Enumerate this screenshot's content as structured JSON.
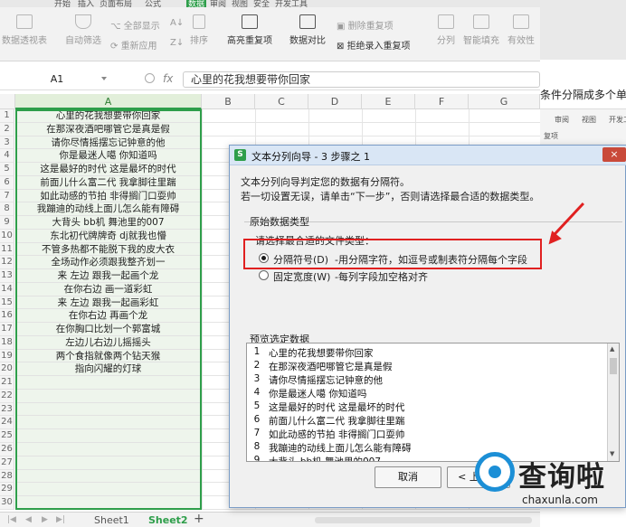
{
  "ribbon": {
    "tabs": [
      "开始",
      "插入",
      "页面布局",
      "公式",
      "数据",
      "审阅",
      "视图",
      "安全",
      "开发工具"
    ],
    "buttons": {
      "pivot": "数据透视表",
      "auto_filter": "自动筛选",
      "show_all": "全部显示",
      "reapply": "重新应用",
      "sort_asc": "A↓",
      "sort_desc": "Z↓",
      "sort": "排序",
      "highlight_dup": "高亮重复项",
      "data_compare": "数据对比",
      "remove_dup": "删除重复项",
      "reject_dup": "拒绝录入重复项",
      "split": "分列",
      "smart_fill": "智能填充",
      "validity": "有效性"
    }
  },
  "formula_bar": {
    "name_box": "A1",
    "fx": "fx",
    "content": "心里的花我想要带你回家"
  },
  "columns": [
    "A",
    "B",
    "C",
    "D",
    "E",
    "F",
    "G"
  ],
  "rows": [
    "1",
    "2",
    "3",
    "4",
    "5",
    "6",
    "7",
    "8",
    "9",
    "10",
    "11",
    "12",
    "13",
    "14",
    "15",
    "16",
    "17",
    "18",
    "19",
    "20",
    "21",
    "22",
    "23",
    "24",
    "25",
    "26",
    "27",
    "28",
    "29",
    "30"
  ],
  "cells_a": [
    "心里的花我想要带你回家",
    "在那深夜酒吧哪管它是真是假",
    "请你尽情摇摆忘记钟意的他",
    "你是最迷人噶 你知道吗",
    "这是最好的时代 这是最坏的时代",
    "前面儿什么富二代 我拿脚往里踹",
    "如此动感的节拍 非得搁门口耍帅",
    "我蹦迪的动线上面儿怎么能有障碍",
    "大背头 bb机 舞池里的007",
    "东北初代牌牌奇 dj就我也懵",
    "不管多热都不能脱下我的皮大衣",
    "全场动作必须跟我整齐划一",
    "来 左边 跟我一起画个龙",
    "在你右边 画一道彩虹",
    "来 左边 跟我一起画彩虹",
    "在你右边 再画个龙",
    "在你胸口比划一个郭富城",
    "左边儿右边儿摇摇头",
    "两个食指就像两个钻天猴",
    "指向闪耀的灯球"
  ],
  "sheets": {
    "tabs": [
      "Sheet1",
      "Sheet2"
    ],
    "active": "Sheet2",
    "add": "+"
  },
  "right_panel": {
    "caption": "条件分隔成多个单",
    "mini_tabs": [
      "审阅",
      "视图",
      "开发工"
    ],
    "mini_label": "复项"
  },
  "dialog": {
    "title": "文本分列向导 - 3 步骤之 1",
    "close": "×",
    "desc1": "文本分列向导判定您的数据有分隔符。",
    "desc2": "若一切设置无误，请单击“下一步”，否则请选择最合适的数据类型。",
    "group_label": "原始数据类型",
    "type_prompt": "请选择最合适的文件类型：",
    "option_delimited": "分隔符号(D)",
    "option_delimited_desc": "-用分隔字符，如逗号或制表符分隔每个字段",
    "option_fixed": "固定宽度(W)",
    "option_fixed_desc": "-每列字段加空格对齐",
    "preview_label": "预览选定数据",
    "preview_rows": [
      {
        "n": "1",
        "t": "心里的花我想要带你回家"
      },
      {
        "n": "2",
        "t": "在那深夜酒吧哪管它是真是假"
      },
      {
        "n": "3",
        "t": "请你尽情摇摆忘记钟意的他"
      },
      {
        "n": "4",
        "t": "你是最迷人噶 你知道吗"
      },
      {
        "n": "5",
        "t": "这是最好的时代 这是最坏的时代"
      },
      {
        "n": "6",
        "t": "前面儿什么富二代 我拿脚往里踹"
      },
      {
        "n": "7",
        "t": "如此动感的节拍 非得搁门口耍帅"
      },
      {
        "n": "8",
        "t": "我蹦迪的动线上面儿怎么能有障碍"
      },
      {
        "n": "9",
        "t": "大背头 bb机 舞池里的007"
      }
    ],
    "cancel": "取消",
    "prev": "< 上一步"
  },
  "watermark": {
    "text": "查询啦",
    "url": "chaxunla.com"
  },
  "colors": {
    "accent": "#2e9e4a",
    "highlight_red": "#e02020",
    "selection_fill": "#eef5ec"
  }
}
